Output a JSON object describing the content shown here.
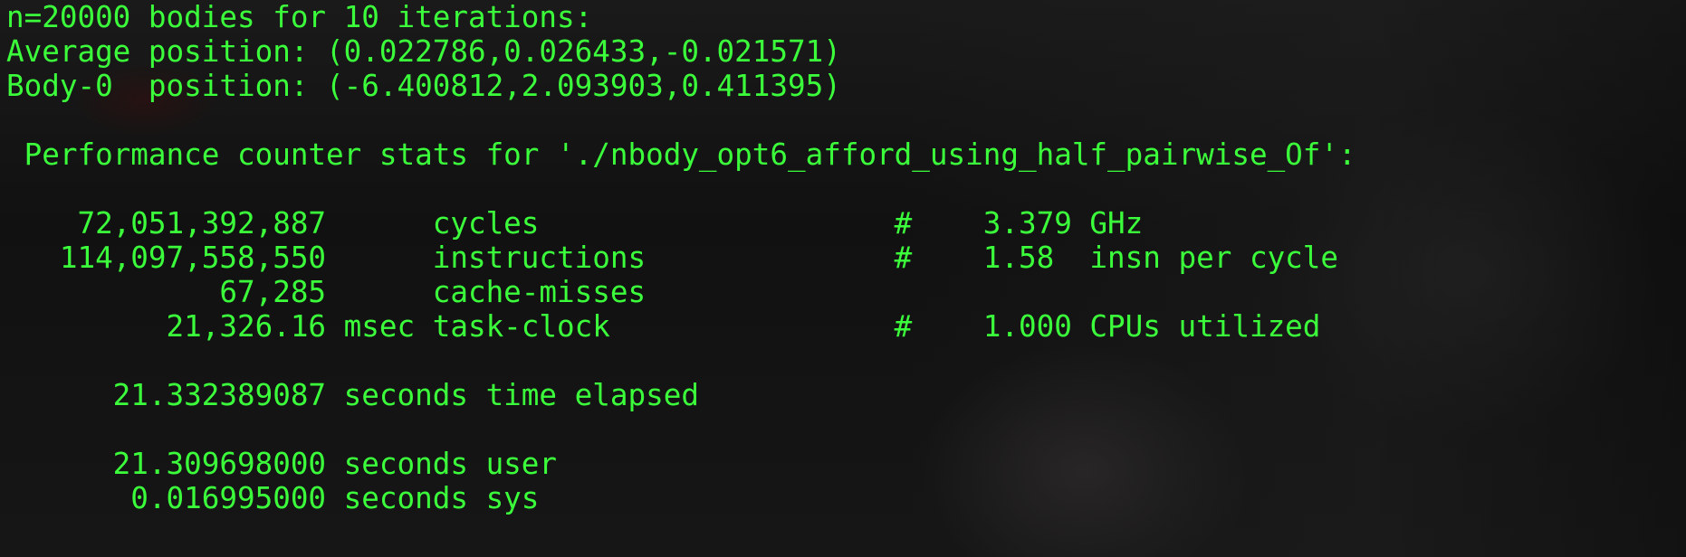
{
  "colors": {
    "text": "#3cff3c",
    "background": "#151515"
  },
  "terminal": {
    "lines": [
      "n=20000 bodies for 10 iterations:",
      "Average position: (0.022786,0.026433,-0.021571)",
      "Body-0  position: (-6.400812,2.093903,0.411395)",
      "",
      " Performance counter stats for './nbody_opt6_afford_using_half_pairwise_Of':",
      "",
      "    72,051,392,887      cycles                    #    3.379 GHz",
      "   114,097,558,550      instructions              #    1.58  insn per cycle",
      "            67,285      cache-misses",
      "         21,326.16 msec task-clock                #    1.000 CPUs utilized",
      "",
      "      21.332389087 seconds time elapsed",
      "",
      "      21.309698000 seconds user",
      "       0.016995000 seconds sys"
    ]
  }
}
